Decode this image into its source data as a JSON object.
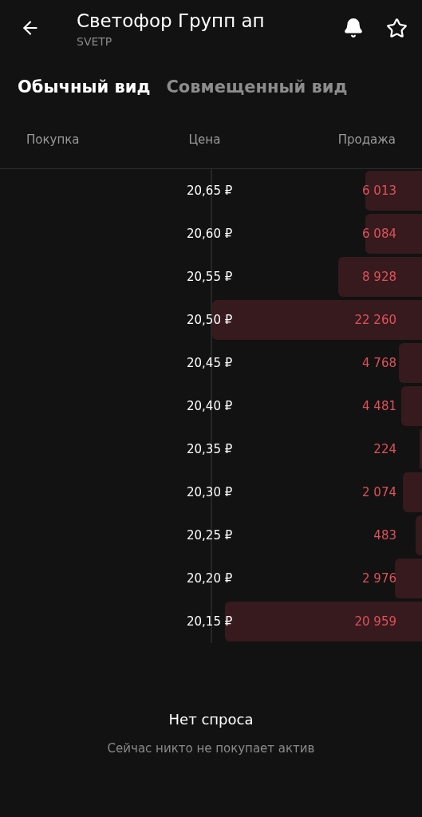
{
  "header": {
    "title": "Светофор Групп ап",
    "ticker": "SVETP"
  },
  "tabs": [
    {
      "label": "Обычный вид",
      "selected": true
    },
    {
      "label": "Совмещенный вид",
      "selected": false
    }
  ],
  "columns": [
    "Покупка",
    "Цена",
    "Продажа"
  ],
  "rows": [
    {
      "price": "20,65 ₽",
      "sell": "6 013",
      "level": 0.27
    },
    {
      "price": "20,60 ₽",
      "sell": "6 084",
      "level": 0.27
    },
    {
      "price": "20,55 ₽",
      "sell": "8 928",
      "level": 0.4
    },
    {
      "price": "20,50 ₽",
      "sell": "22 260",
      "level": 1.0
    },
    {
      "price": "20,45 ₽",
      "sell": "4 768",
      "level": 0.11
    },
    {
      "price": "20,40 ₽",
      "sell": "4 481",
      "level": 0.1
    },
    {
      "price": "20,35 ₽",
      "sell": "224",
      "level": 0.01
    },
    {
      "price": "20,30 ₽",
      "sell": "2 074",
      "level": 0.09
    },
    {
      "price": "20,25 ₽",
      "sell": "483",
      "level": 0.03
    },
    {
      "price": "20,20 ₽",
      "sell": "2 976",
      "level": 0.13
    },
    {
      "price": "20,15 ₽",
      "sell": "20 959",
      "level": 0.94
    }
  ],
  "empty_state": {
    "title": "Нет спроса",
    "message": "Сейчас никто не покупает актив"
  }
}
